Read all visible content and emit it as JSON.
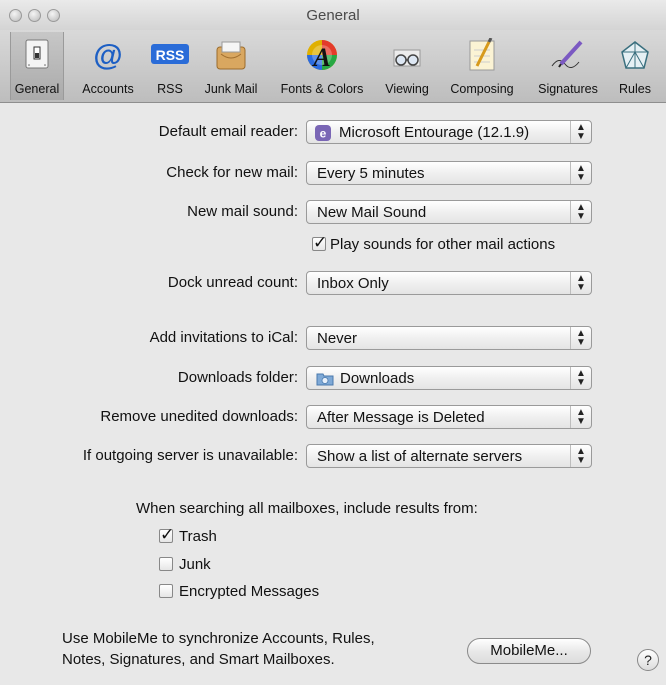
{
  "window": {
    "title": "General"
  },
  "toolbar": {
    "items": [
      {
        "label": "General",
        "icon": "switch-icon"
      },
      {
        "label": "Accounts",
        "icon": "at-sign-icon"
      },
      {
        "label": "RSS",
        "icon": "rss-icon"
      },
      {
        "label": "Junk Mail",
        "icon": "junk-mail-icon"
      },
      {
        "label": "Fonts & Colors",
        "icon": "font-colors-icon"
      },
      {
        "label": "Viewing",
        "icon": "glasses-icon"
      },
      {
        "label": "Composing",
        "icon": "pencil-paper-icon"
      },
      {
        "label": "Signatures",
        "icon": "pen-signature-icon"
      },
      {
        "label": "Rules",
        "icon": "rules-icon"
      }
    ],
    "rss_badge": "RSS",
    "at_symbol": "@",
    "fonts_letter": "A"
  },
  "form": {
    "default_reader": {
      "label": "Default email reader:",
      "value": "Microsoft Entourage (12.1.9)"
    },
    "check_mail": {
      "label": "Check for new mail:",
      "value": "Every 5 minutes"
    },
    "new_mail_sound": {
      "label": "New mail sound:",
      "value": "New Mail Sound"
    },
    "play_sounds": {
      "label": "Play sounds for other mail actions",
      "checked": true
    },
    "dock_count": {
      "label": "Dock unread count:",
      "value": "Inbox Only"
    },
    "invitations": {
      "label": "Add invitations to iCal:",
      "value": "Never"
    },
    "downloads_folder": {
      "label": "Downloads folder:",
      "value": "Downloads"
    },
    "remove_downloads": {
      "label": "Remove unedited downloads:",
      "value": "After Message is Deleted"
    },
    "outgoing_server": {
      "label": "If outgoing server is unavailable:",
      "value": "Show a list of alternate servers"
    }
  },
  "search": {
    "heading": "When searching all mailboxes, include results from:",
    "options": [
      {
        "label": "Trash",
        "checked": true
      },
      {
        "label": "Junk",
        "checked": false
      },
      {
        "label": "Encrypted Messages",
        "checked": false
      }
    ]
  },
  "mobileme": {
    "line1": "Use MobileMe to synchronize Accounts, Rules,",
    "line2": "Notes, Signatures, and Smart Mailboxes.",
    "button": "MobileMe..."
  },
  "help_label": "?",
  "checkmark": "✓",
  "popup_arrows": "▲▼",
  "colors": {
    "annotation_arrow": "#e8141b",
    "toolbar": "#c8c8c8"
  }
}
